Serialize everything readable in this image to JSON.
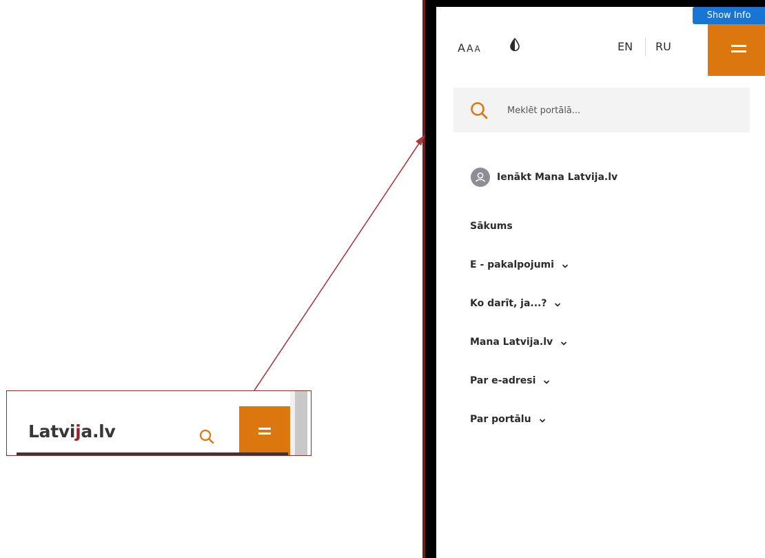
{
  "header_crop": {
    "logo_text_prefix": "Latvi",
    "logo_text_mark": "j",
    "logo_text_suffix": "a.lv"
  },
  "top_bar": {
    "show_info": "Show Info",
    "font_size_labels": [
      "A",
      "A",
      "A"
    ],
    "lang_en": "EN",
    "lang_ru": "RU"
  },
  "search": {
    "placeholder": "Meklēt portālā..."
  },
  "login": {
    "label": "Ienākt Mana Latvija.lv"
  },
  "nav": {
    "items": [
      {
        "label": "Sākums",
        "has_submenu": false
      },
      {
        "label": "E - pakalpojumi",
        "has_submenu": true
      },
      {
        "label": "Ko darīt, ja...?",
        "has_submenu": true
      },
      {
        "label": "Mana Latvija.lv",
        "has_submenu": true
      },
      {
        "label": "Par e-adresi",
        "has_submenu": true
      },
      {
        "label": "Par portālu",
        "has_submenu": true
      }
    ]
  },
  "colors": {
    "accent_orange": "#dc760f",
    "logo_red": "#9c1f2c",
    "show_info_blue": "#1876d2",
    "arrow": "#a93a3a"
  },
  "icons": [
    "search-icon",
    "menu-icon",
    "contrast-icon",
    "user-icon",
    "chevron-down-icon"
  ]
}
